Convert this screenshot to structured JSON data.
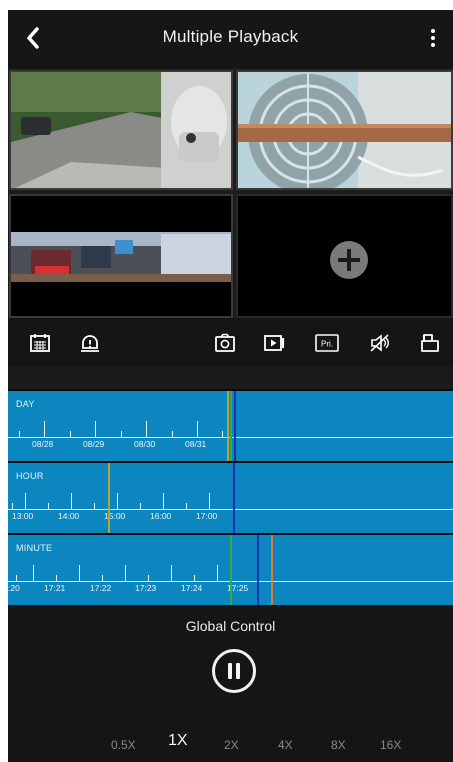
{
  "header": {
    "title": "Multiple Playback",
    "back_icon": "chevron-left-icon",
    "menu_icon": "more-vertical-icon"
  },
  "playback_grid": {
    "cells": [
      {
        "name": "camera-view-1",
        "content": "video"
      },
      {
        "name": "camera-view-2",
        "content": "video"
      },
      {
        "name": "camera-view-3",
        "content": "video"
      },
      {
        "name": "camera-view-4",
        "content": "empty",
        "icon": "add-icon"
      }
    ]
  },
  "toolbar": {
    "left_icons": [
      "calendar-icon",
      "alarm-icon"
    ],
    "right_icons": [
      "snapshot-icon",
      "record-icon",
      "private-icon",
      "mute-icon",
      "layout-icon"
    ],
    "private_label": "Pri."
  },
  "timeline": {
    "day": {
      "label": "DAY",
      "ticks": [
        "08/28",
        "08/29",
        "08/30",
        "08/31"
      ]
    },
    "hour": {
      "label": "HOUR",
      "ticks": [
        "13:00",
        "14:00",
        "15:00",
        "16:00",
        "17:00"
      ]
    },
    "minute": {
      "label": "MINUTE",
      "ticks": [
        ":20",
        "17:21",
        "17:22",
        "17:23",
        "17:24",
        "17:25"
      ]
    },
    "colors": {
      "background": "#0c86bf",
      "olive_marker": "#b4a43a",
      "blue_marker": "#1f2fb8",
      "green_marker": "#3aa845",
      "orange_marker": "#e07a3a"
    }
  },
  "controls": {
    "global_control_label": "Global Control",
    "pause_icon": "pause-icon",
    "speeds": [
      "0.5X",
      "1X",
      "2X",
      "4X",
      "8X",
      "16X"
    ],
    "selected_speed": "1X"
  }
}
